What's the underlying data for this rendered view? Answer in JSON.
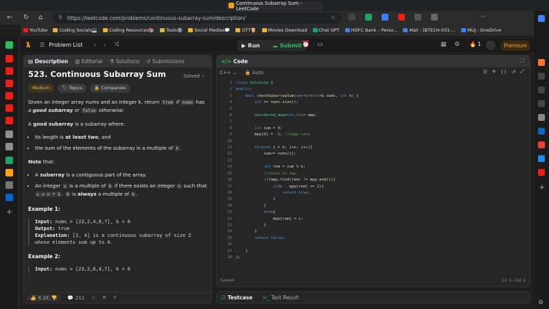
{
  "browser": {
    "tab_title": "Continuous Subarray Sum - LeetCode",
    "url": "https://leetcode.com/problems/continuous-subarray-sum/description/",
    "bookmarks": [
      "YouTube",
      "Coding Socials💻",
      "Coding Resources📚",
      "Tools⚙️",
      "Social Medias💬",
      "OTT🍿",
      "Movies Download",
      "Chat GPT",
      "HDFC Bank – Perso...",
      "Mail - [BTECH-031-...",
      "MUJ - OneDrive"
    ]
  },
  "lc_nav": {
    "problem_list": "Problem List",
    "run": "Run",
    "submit": "Submit",
    "streak": "1",
    "premium": "Premium"
  },
  "left_tabs": {
    "description": "Description",
    "editorial": "Editorial",
    "solutions": "Solutions",
    "submissions": "Submissions"
  },
  "problem": {
    "title": "523. Continuous Subarray Sum",
    "status": "Solved",
    "difficulty": "Medium",
    "chips": {
      "topics": "Topics",
      "companies": "Companies"
    },
    "p1_a": "Given an integer array nums and an integer k, return ",
    "p1_true": "true",
    "p1_b": " if ",
    "p1_nums": "nums",
    "p1_c": " has a ",
    "p1_good": "good subarray",
    "p1_d": " or ",
    "p1_false": "false",
    "p1_e": " otherwise.",
    "p2_a": "A ",
    "p2_good": "good subarray",
    "p2_b": " is a subarray where:",
    "b1_a": "its length is ",
    "b1_b": "at least two",
    "b1_c": ", and",
    "b2_a": "the sum of the elements of the subarray is a multiple of ",
    "b2_k": "k",
    "b2_b": ".",
    "note": "Note",
    "note_b": " that:",
    "n1_a": "A ",
    "n1_b": "subarray",
    "n1_c": " is a contiguous part of the array.",
    "n2_a": "An integer ",
    "n2_x": "x",
    "n2_b": " is a multiple of ",
    "n2_k": "k",
    "n2_c": " if there exists an integer ",
    "n2_n": "n",
    "n2_d": " such that ",
    "n2_eq": "x = n * k",
    "n2_e": ". ",
    "n2_zero": "0",
    "n2_f": " is ",
    "n2_always": "always",
    "n2_g": " a multiple of ",
    "n2_k2": "k",
    "n2_h": ".",
    "ex1_title": "Example 1:",
    "ex1_input_label": "Input:",
    "ex1_input": "nums = [23,2,4,6,7], k = 6",
    "ex1_output_label": "Output:",
    "ex1_output": "true",
    "ex1_expl_label": "Explanation:",
    "ex1_expl": "[2, 4] is a continuous subarray of size 2 whose elements sum up to 6.",
    "ex2_title": "Example 2:",
    "ex2_input_label": "Input:",
    "ex2_input": "nums = [23,2,6,4,7], k = 6"
  },
  "footer": {
    "likes": "6.1K",
    "comments": "211"
  },
  "code_panel": {
    "title": "Code",
    "lang": "C++",
    "mode": "Auto",
    "saved": "Saved",
    "position": "Ln 1, Col 1"
  },
  "console": {
    "testcase": "Testcase",
    "result": "Test Result"
  },
  "icons": [
    "chevron-left-icon",
    "chevron-right-icon",
    "shuffle-icon",
    "play-icon",
    "cloud-upload-icon",
    "alarm-icon",
    "note-icon",
    "grid-icon",
    "gear-icon",
    "fire-icon",
    "thumb-up-icon",
    "thumb-down-icon",
    "comment-icon",
    "star-icon",
    "share-icon",
    "help-icon"
  ]
}
